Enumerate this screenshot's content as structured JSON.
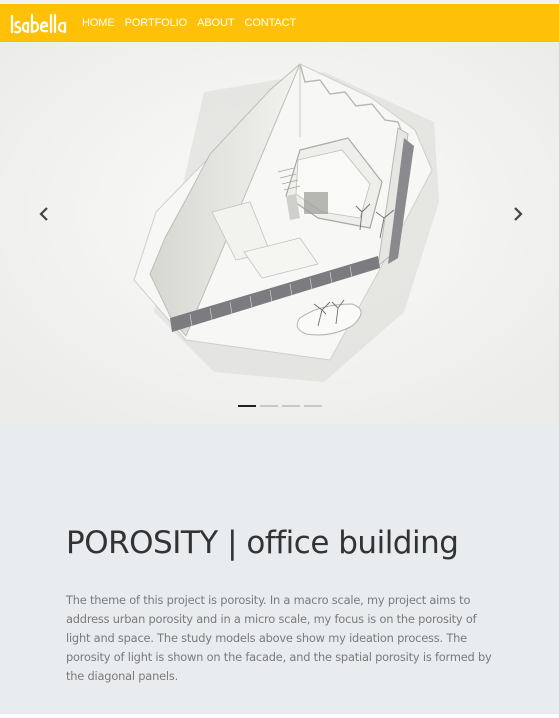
{
  "colors": {
    "navbar_bg": "#ffc107",
    "content_bg": "#e9ecef",
    "title": "#333333",
    "text": "#7a7a7a"
  },
  "brand": {
    "logo_text": "Isabella",
    "logo_icon": "isabella-wordmark"
  },
  "nav": {
    "items": [
      {
        "label": "HOME"
      },
      {
        "label": "PORTFOLIO"
      },
      {
        "label": "ABOUT"
      },
      {
        "label": "CONTACT"
      }
    ]
  },
  "carousel": {
    "image": "architectural-model-photo",
    "prev_icon": "chevron-left-icon",
    "next_icon": "chevron-right-icon",
    "slide_count": 4,
    "active_index": 0
  },
  "project": {
    "title": "POROSITY | office building",
    "description": "The theme of this project is porosity. In a macro scale, my project aims to address urban porosity and in a micro scale, my focus is on the porosity of light and space. The study models above show my ideation process. The porosity of light is shown on the facade, and the spatial porosity is formed by the diagonal panels."
  }
}
